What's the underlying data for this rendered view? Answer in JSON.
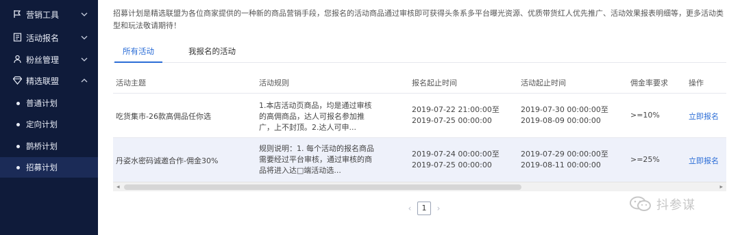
{
  "sidebar": {
    "menus": [
      {
        "label": "营销工具",
        "icon": "flag-icon"
      },
      {
        "label": "活动报名",
        "icon": "form-icon"
      },
      {
        "label": "粉丝管理",
        "icon": "fans-icon"
      },
      {
        "label": "精选联盟",
        "icon": "diamond-icon"
      }
    ],
    "sub_items": [
      {
        "label": "普通计划"
      },
      {
        "label": "定向计划"
      },
      {
        "label": "鹊桥计划"
      },
      {
        "label": "招募计划"
      }
    ]
  },
  "main": {
    "description": "招募计划是精选联盟为各位商家提供的一种新的商品营销手段，您报名的活动商品通过审核即可获得头条系多平台曝光资源、优质带货红人优先推广、活动效果报表明细等，更多活动类型和玩法敬请期待！",
    "tabs": [
      {
        "label": "所有活动"
      },
      {
        "label": "我报名的活动"
      }
    ],
    "table": {
      "headers": [
        "活动主题",
        "活动规则",
        "报名起止时间",
        "活动起止时间",
        "佣金率要求",
        "操作"
      ],
      "rows": [
        {
          "theme": "吃货集市-26款高佣品任你选",
          "rule": "1.本店活动页商品，均是通过审核的高佣商品，达人可报名参加推广，上不封顶。2.达人可申...",
          "signup_start": "2019-07-22 21:00:00至",
          "signup_end": "2019-07-25 00:00:00",
          "activity_start": "2019-07-30 00:00:00至",
          "activity_end": "2019-08-09 00:00:00",
          "commission": ">=10%",
          "action": "立即报名"
        },
        {
          "theme": "丹姿水密码诚邀合作-佣金30%",
          "rule": "规则说明：1. 每个活动的报名商品需要经过平台审核，通过审核的商品将进入达□端活动选...",
          "signup_start": "2019-07-24 00:00:00至",
          "signup_end": "2019-07-25 00:00:00",
          "activity_start": "2019-07-29 00:00:00至",
          "activity_end": "2019-08-11 00:00:00",
          "commission": ">=25%",
          "action": "立即报名"
        }
      ]
    },
    "pagination": {
      "current_page": "1",
      "prev": "‹",
      "next": "›"
    },
    "scrollbar": {
      "left": "◂",
      "right": "▸"
    }
  },
  "watermark": {
    "text": "抖参谋"
  },
  "colors": {
    "sidebar_bg": "#0f1b3a",
    "sidebar_active": "#1b2b57",
    "accent": "#2a6cd6",
    "alt_row": "#eef1fa"
  }
}
